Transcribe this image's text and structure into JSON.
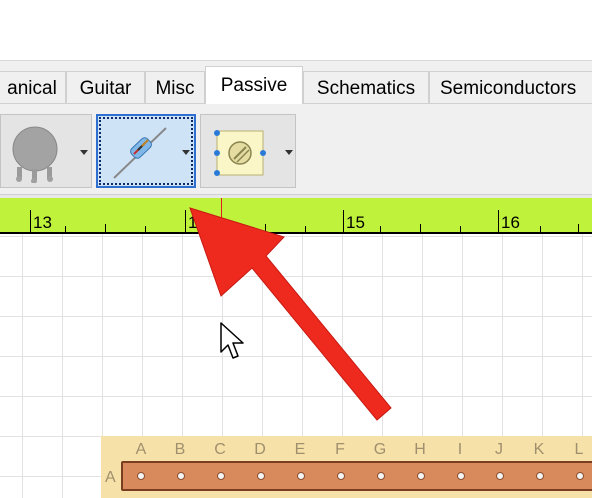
{
  "tabs": [
    {
      "label": "anical",
      "active": false
    },
    {
      "label": "Guitar",
      "active": false
    },
    {
      "label": "Misc",
      "active": false
    },
    {
      "label": "Passive",
      "active": true
    },
    {
      "label": "Schematics",
      "active": false
    },
    {
      "label": "Semiconductors",
      "active": false
    }
  ],
  "toolbar": {
    "items": [
      {
        "icon": "potentiometer-icon",
        "selected": false
      },
      {
        "icon": "resistor-icon",
        "selected": true
      },
      {
        "icon": "trimmer-icon",
        "selected": false
      }
    ]
  },
  "ruler": {
    "labels": [
      "13",
      "14",
      "15",
      "16"
    ],
    "label_visible": [
      "13",
      "1",
      "15",
      "16"
    ],
    "color": "#bff23a",
    "marker_color": "#e02020"
  },
  "board": {
    "columns": [
      "A",
      "B",
      "C",
      "D",
      "E",
      "F",
      "G",
      "H",
      "I",
      "J",
      "K",
      "L"
    ],
    "rows": [
      "A"
    ],
    "strip_color": "#d98a5c"
  },
  "annotation": {
    "type": "arrow",
    "color": "#ee2a1e"
  }
}
